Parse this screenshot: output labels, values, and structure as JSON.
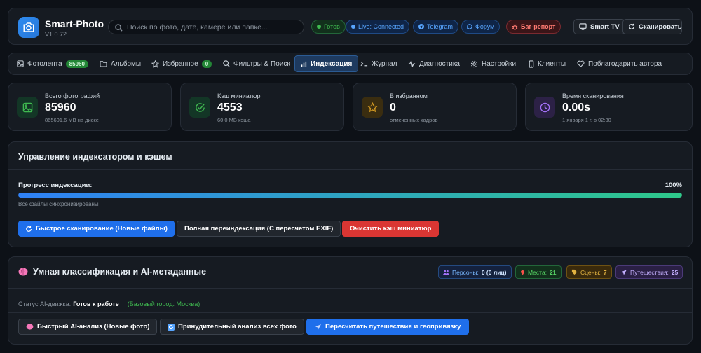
{
  "header": {
    "app_name": "Smart-Photo",
    "version": "V1.0.72",
    "search_placeholder": "Поиск по фото, дате, камере или папке...",
    "status_ready": "Готов",
    "live": "Live: Connected",
    "telegram": "Telegram",
    "forum": "Форум",
    "bug_report": "Баг-репорт",
    "smart_tv": "Smart TV",
    "scan": "Сканировать"
  },
  "tabs": [
    {
      "label": "Фотолента",
      "badge": "85960",
      "icon": "image-icon"
    },
    {
      "label": "Альбомы",
      "icon": "folder-icon"
    },
    {
      "label": "Избранное",
      "badge": "0",
      "icon": "star-icon"
    },
    {
      "label": "Фильтры & Поиск",
      "icon": "search-icon"
    },
    {
      "label": "Индексация",
      "icon": "bar-chart-icon",
      "active": true
    },
    {
      "label": "Журнал",
      "icon": "terminal-icon"
    },
    {
      "label": "Диагностика",
      "icon": "activity-icon"
    },
    {
      "label": "Настройки",
      "icon": "gear-icon"
    },
    {
      "label": "Клиенты",
      "icon": "phone-icon"
    },
    {
      "label": "Поблагодарить автора",
      "icon": "heart-icon"
    }
  ],
  "stats": [
    {
      "label": "Всего фотографий",
      "value": "85960",
      "sub": "865601.6 MB на диске",
      "icon": "image-icon",
      "color": "#3fb950"
    },
    {
      "label": "Кэш миниатюр",
      "value": "4553",
      "sub": "60.0 MB кэша",
      "icon": "check-circle-icon",
      "color": "#3fb950"
    },
    {
      "label": "В избранном",
      "value": "0",
      "sub": "отмеченных кадров",
      "icon": "star-icon",
      "color": "#d29922"
    },
    {
      "label": "Время сканирования",
      "value": "0.00s",
      "sub": "1 января 1 г. в 02:30",
      "icon": "clock-icon",
      "color": "#a371f7"
    }
  ],
  "indexer": {
    "title": "Управление индексатором и кэшем",
    "progress_label": "Прогресс индексации:",
    "progress_text": "100%",
    "progress": 1.0,
    "progress_sub": "Все файлы синхронизированы",
    "quick_scan": "Быстрое сканирование (Новые файлы)",
    "full_reindex": "Полная переиндексация (С пересчетом EXIF)",
    "clear_cache": "Очистить кэш миниатюр"
  },
  "ai": {
    "title": "Умная классификация и AI-метаданные",
    "tags": [
      {
        "label": "Персоны:",
        "value": "0 (0 лиц)",
        "icon": "people-icon"
      },
      {
        "label": "Места:",
        "value": "21",
        "icon": "pin-icon"
      },
      {
        "label": "Сцены:",
        "value": "7",
        "icon": "tag-icon"
      },
      {
        "label": "Путешествия:",
        "value": "25",
        "icon": "plane-icon"
      }
    ],
    "status_label": "Статус AI-движка:",
    "status_value": "Готов к работе",
    "base_city": "(Базовый город: Москва)",
    "quick_ai": "Быстрый AI-анализ (Новые фото)",
    "force_all": "Принудительный анализ всех фото",
    "recalc_trips": "Пересчитать путешествия и геопривязку"
  }
}
